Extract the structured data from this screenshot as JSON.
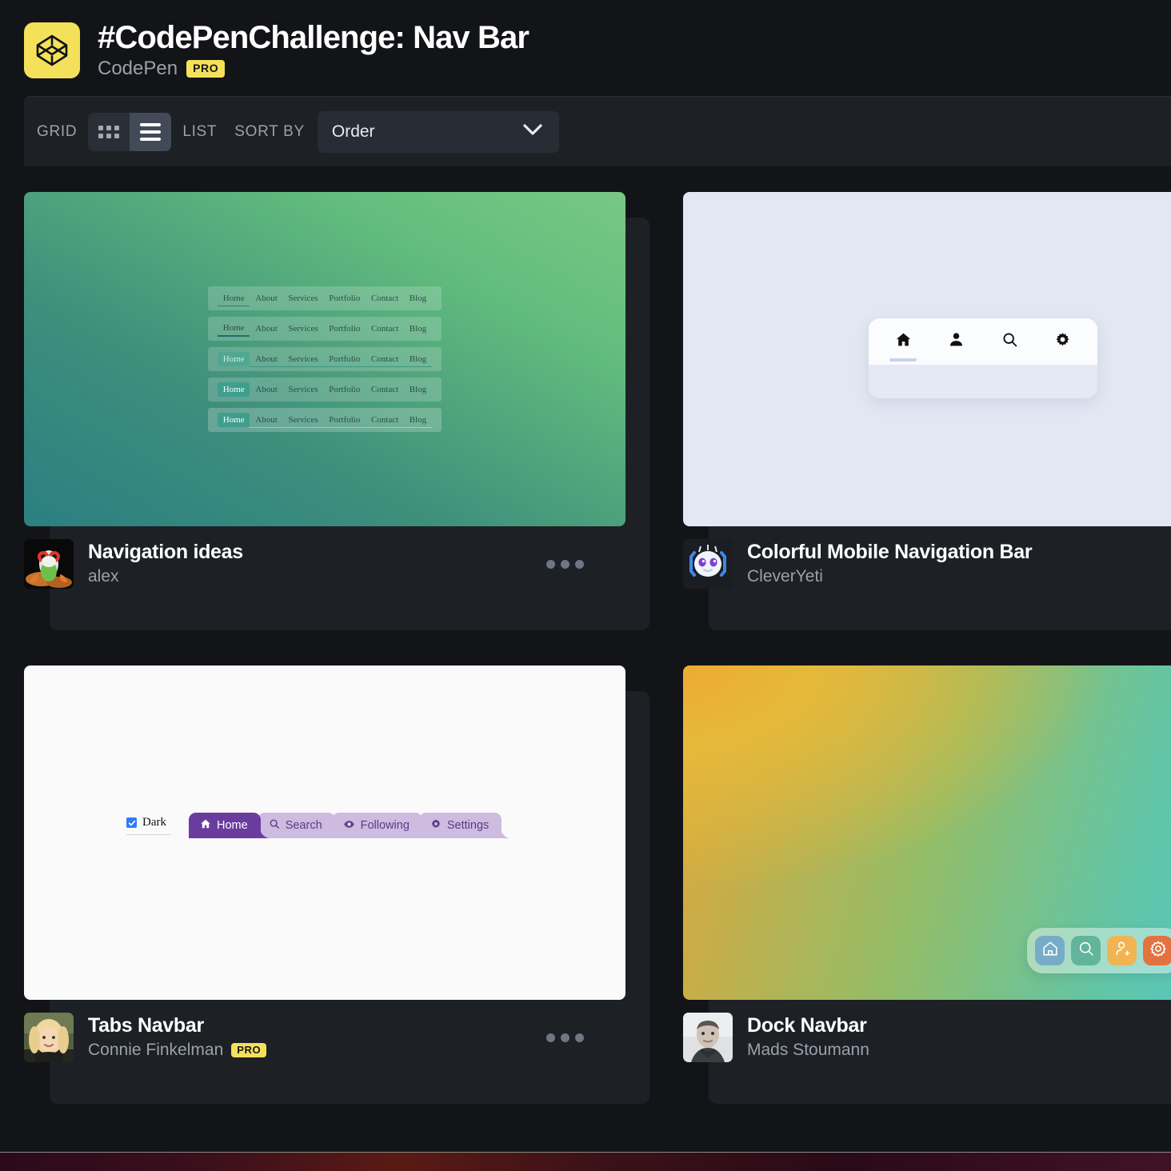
{
  "header": {
    "logo_icon": "codepen-logo-icon",
    "title": "#CodePenChallenge: Nav Bar",
    "owner": "CodePen",
    "pro_badge": "PRO"
  },
  "toolbar": {
    "grid_label": "GRID",
    "grid_icon": "grid-view-icon",
    "list_icon": "list-view-icon",
    "list_label": "LIST",
    "sort_label": "SORT BY",
    "sort_value": "Order",
    "sort_chevron_icon": "chevron-down-icon",
    "active_view": "list"
  },
  "colors": {
    "page_bg": "#131417",
    "card_bg": "#1d2025",
    "accent_yellow": "#f5e05a",
    "muted_text": "#9ba1ac",
    "toggle_active": "#434a57",
    "toggle_inactive": "#2a2e36"
  },
  "pens": [
    {
      "title": "Navigation ideas",
      "author": "alex",
      "author_pro": false,
      "avatar_icon": "frog-avatar",
      "more_icon": "more-options-icon",
      "preview": {
        "type": "nav-ideas",
        "gradient_from": "#2b7f81",
        "gradient_to": "#77c884",
        "nav_items": [
          "Home",
          "About",
          "Services",
          "Portfolio",
          "Contact",
          "Blog"
        ],
        "row_count": 5
      }
    },
    {
      "title": "Colorful Mobile Navigation Bar",
      "author": "CleverYeti",
      "author_pro": false,
      "avatar_icon": "yeti-avatar",
      "more_icon": "more-options-icon",
      "preview": {
        "type": "mobile-nav",
        "bg": "#e2e7f3",
        "bar_bg": "#fbfcfe",
        "icons": [
          "home-icon",
          "person-icon",
          "search-icon",
          "gear-icon"
        ],
        "active_index": 0
      }
    },
    {
      "title": "Tabs Navbar",
      "author": "Connie Finkelman",
      "author_pro": true,
      "author_pro_badge": "PRO",
      "avatar_icon": "woman-avatar",
      "more_icon": "more-options-icon",
      "preview": {
        "type": "tabs-nav",
        "bg": "#fafafa",
        "checkbox_label": "Dark",
        "checkbox_checked": true,
        "active_color": "#6b3ca0",
        "idle_color": "#cdbbe0",
        "tabs": [
          {
            "label": "Home",
            "icon": "home-icon",
            "active": true
          },
          {
            "label": "Search",
            "icon": "search-icon",
            "active": false
          },
          {
            "label": "Following",
            "icon": "eye-icon",
            "active": false
          },
          {
            "label": "Settings",
            "icon": "gear-icon",
            "active": false
          }
        ]
      }
    },
    {
      "title": "Dock Navbar",
      "author": "Mads Stoumann",
      "author_pro": false,
      "avatar_icon": "man-avatar",
      "more_icon": "more-options-icon",
      "preview": {
        "type": "dock-nav",
        "gradient_stops": [
          "#e0a63a",
          "#93bd68",
          "#62c5a6",
          "#4fc9d2"
        ],
        "buttons": [
          {
            "icon": "home-icon",
            "bg": "#77acc9"
          },
          {
            "icon": "search-icon",
            "bg": "#62b49a"
          },
          {
            "icon": "person-add-icon",
            "bg": "#f0b452"
          },
          {
            "icon": "gear-icon",
            "bg": "#e2733f"
          }
        ]
      }
    }
  ]
}
